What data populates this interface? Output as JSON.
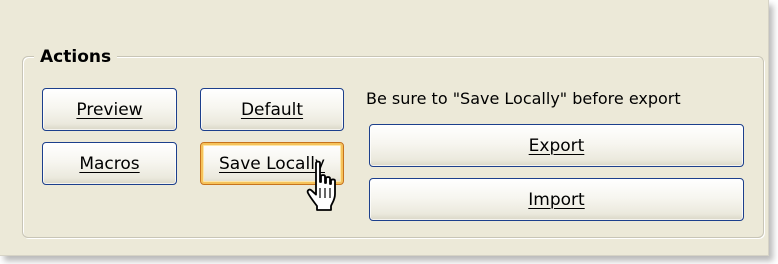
{
  "group": {
    "title": "Actions"
  },
  "buttons": {
    "preview": "Preview",
    "default": "Default",
    "macros": "Macros",
    "save_locally": "Save Locally",
    "export": "Export",
    "import": "Import"
  },
  "hint_text": "Be sure to \"Save Locally\" before export",
  "hover_button": "save_locally",
  "cursor_icon": "hand-pointer-icon",
  "colors": {
    "panel_bg": "#ece9d8",
    "button_border": "#1c3f8c",
    "hover_border": "#c7731c",
    "hover_glow": "#f5c25a"
  }
}
